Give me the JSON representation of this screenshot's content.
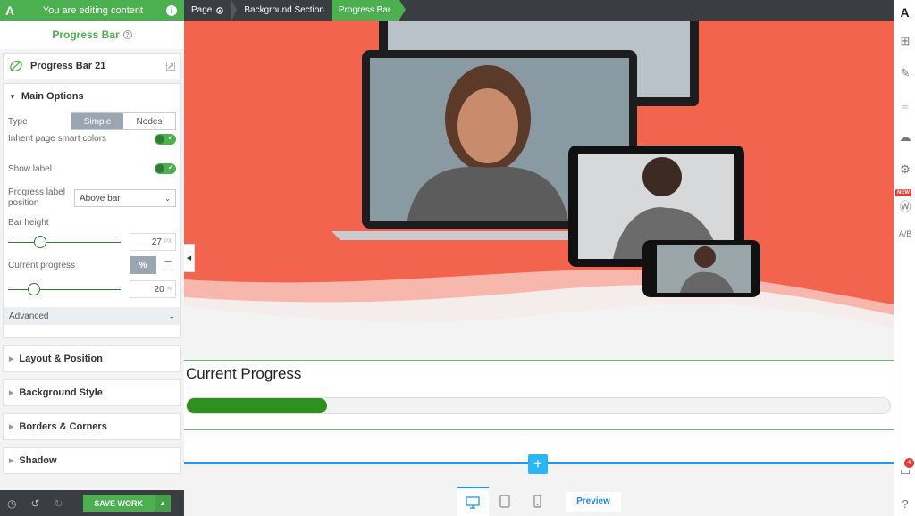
{
  "topbar": {
    "brand": "A",
    "editing_text": "You are editing content",
    "breadcrumb": [
      "Page",
      "Background Section",
      "Progress Bar"
    ]
  },
  "sidebar": {
    "panel_title": "Progress Bar",
    "element_name": "Progress Bar 21",
    "main_options_label": "Main Options",
    "type_label": "Type",
    "type_options": [
      "Simple",
      "Nodes"
    ],
    "type_selected": "Simple",
    "inherit_colors_label": "Inherit page smart colors",
    "inherit_colors_on": true,
    "show_label_label": "Show label",
    "show_label_on": true,
    "label_position_label": "Progress label position",
    "label_position_value": "Above bar",
    "bar_height_label": "Bar height",
    "bar_height_value": "27",
    "bar_height_unit": "PX",
    "current_progress_label": "Current progress",
    "current_progress_unit_btn": "%",
    "current_progress_value": "20",
    "current_progress_unit": "%",
    "advanced_label": "Advanced",
    "sections": [
      "Layout & Position",
      "Background Style",
      "Borders & Corners",
      "Shadow"
    ]
  },
  "bottombar": {
    "save_label": "SAVE WORK"
  },
  "canvas": {
    "progress_title": "Current Progress",
    "progress_fraction": 0.2,
    "preview_label": "Preview"
  },
  "right_bar": {
    "logo": "A",
    "new_badge": "NEW",
    "ab_label": "A/B",
    "notifications_count": "4"
  },
  "colors": {
    "brand_green": "#4caf50",
    "progress_fill": "#2f8f1f",
    "hero_coral": "#f2644e",
    "accent_blue": "#29b6f6"
  }
}
